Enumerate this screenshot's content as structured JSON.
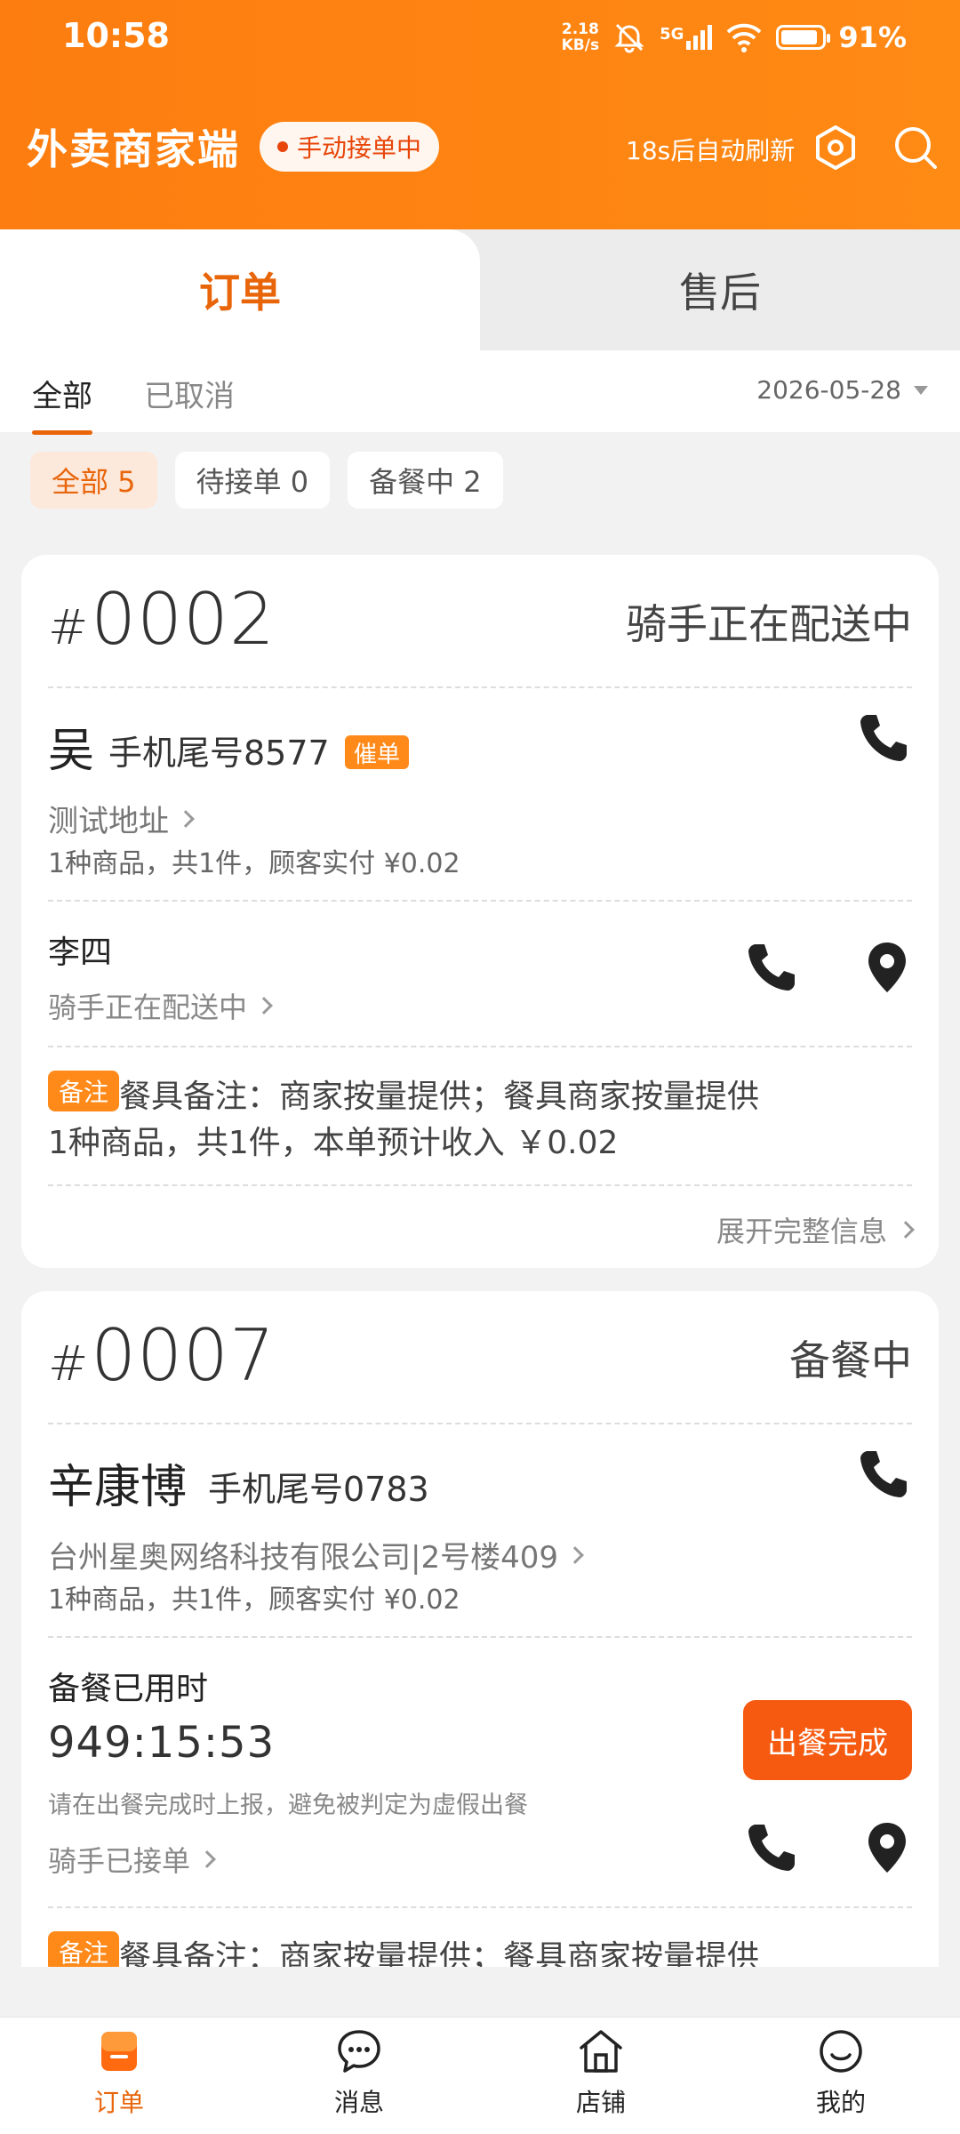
{
  "status_bar": {
    "time": "10:58",
    "net_speed_value": "2.18",
    "net_speed_unit": "KB/s",
    "network": "5G",
    "battery_level": 0.91,
    "battery_text": "91%"
  },
  "header": {
    "title": "外卖商家端",
    "mode_badge": "手动接单中",
    "refresh_text": "18s后自动刷新",
    "icons": [
      "settings-icon",
      "search-icon"
    ]
  },
  "main_tabs": [
    {
      "label": "订单",
      "active": true
    },
    {
      "label": "售后",
      "active": false
    }
  ],
  "sub_tabs": [
    {
      "label": "全部",
      "active": true
    },
    {
      "label": "已取消",
      "active": false
    }
  ],
  "date": "2026-05-28",
  "filters": [
    {
      "label": "全部 5",
      "active": true
    },
    {
      "label": "待接单 0",
      "active": false
    },
    {
      "label": "备餐中 2",
      "active": false
    }
  ],
  "orders": [
    {
      "hash": "#",
      "number": "0002",
      "status": "骑手正在配送中",
      "customer": "吴",
      "phone": "手机尾号8577",
      "badge": "催单",
      "address": "测试地址",
      "summary": "1种商品，共1件，顾客实付 ¥0.02",
      "rider": "李四",
      "rider_status": "骑手正在配送中",
      "note_badge": "备注",
      "note": "餐具备注：商家按量提供；餐具商家按量提供",
      "income": "1种商品，共1件，本单预计收入 ￥0.02",
      "expand": "展开完整信息"
    },
    {
      "hash": "#",
      "number": "0007",
      "status": "备餐中",
      "customer": "辛康博",
      "phone": "手机尾号0783",
      "address": "台州星奥网络科技有限公司|2号楼409",
      "summary": "1种商品，共1件，顾客实付 ¥0.02",
      "prep_label": "备餐已用时",
      "prep_time": "949:15:53",
      "hint": "请在出餐完成时上报，避免被判定为虚假出餐",
      "done_button": "出餐完成",
      "rider_status": "骑手已接单",
      "note_badge": "备注",
      "note": "餐具备注：商家按量提供；餐具商家按量提供"
    }
  ],
  "bottom_nav": [
    {
      "label": "订单",
      "icon": "order-icon",
      "active": true
    },
    {
      "label": "消息",
      "icon": "message-icon",
      "active": false
    },
    {
      "label": "店铺",
      "icon": "store-icon",
      "active": false
    },
    {
      "label": "我的",
      "icon": "profile-icon",
      "active": false
    }
  ],
  "colors": {
    "brand": "#fd7d10",
    "accent": "#e8650a",
    "button": "#f55a10"
  }
}
